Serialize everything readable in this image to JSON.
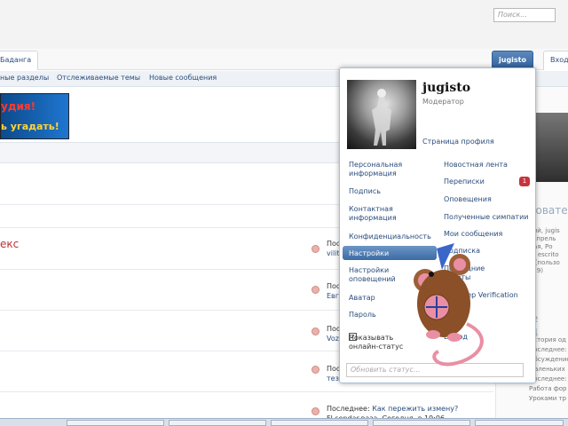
{
  "search": {
    "placeholder": "Поиск..."
  },
  "tabs": {
    "left_label": "Баданга",
    "user_label": "jugisto",
    "login_label": "Вход"
  },
  "subnav": {
    "items": [
      "ные разделы",
      "Отслеживаемые темы",
      "Новые сообщения"
    ]
  },
  "banner": {
    "line1": "удия!",
    "line2": "ь угадать!"
  },
  "forum": {
    "title": "екс"
  },
  "posts": [
    {
      "label": "Послед",
      "link": "vilit"
    },
    {
      "label": "Послед",
      "link": "Евгр"
    },
    {
      "label": "Послед",
      "link": "Voz"
    },
    {
      "label": "Послед",
      "link": "тези"
    },
    {
      "label": "Последнее:",
      "link": "Как пережить измену?",
      "sub": "Fl.sendar.ваза, Сегодня, в 19:06"
    }
  ],
  "sidebar": {
    "head1": "Пользовател",
    "text1": [
      "Долгорский, jugis",
      "Капелла Апрель",
      "Мятяевская, Ро",
      "Полковер, escrito",
      "Всего: 37 (пользо",
      "роботов: 19)"
    ],
    "head2": "Новые сообщ",
    "text2": [
      "История од",
      "Последнее:",
      "Обсуждение",
      "Маленьких",
      "Последнее:",
      "Работа фор",
      "Уроками тр"
    ]
  },
  "dropdown": {
    "username": "jugisto",
    "role": "Модератор",
    "profile_link": "Страница профиля",
    "left_items": [
      "Персональная информация",
      "Подпись",
      "Контактная информация",
      "Конфиденциальность",
      "Настройки",
      "Настройки оповещений",
      "Аватар",
      "Пароль"
    ],
    "right_items": [
      "Новостная лента",
      "Переписки",
      "Оповещения",
      "Полученные симпатии",
      "Мои сообщения",
      "Подписка",
      "Последние визиты",
      "Two-Step Verification",
      "Выход"
    ],
    "badge": "1",
    "checkbox_label": "Показывать онлайн-статус",
    "status_placeholder": "Обновить статус..."
  },
  "colors": {
    "accent": "#3b6aa3",
    "link": "#2b4d7d",
    "badge": "#c8333a"
  }
}
